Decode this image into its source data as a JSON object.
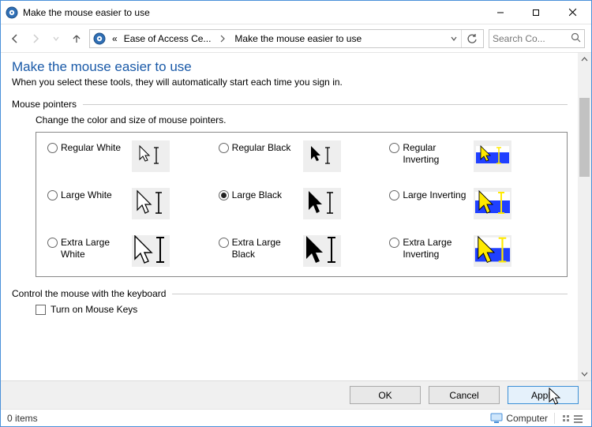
{
  "window": {
    "title": "Make the mouse easier to use"
  },
  "nav": {
    "crumb1": "Ease of Access Ce...",
    "crumb2": "Make the mouse easier to use",
    "search_placeholder": "Search Co..."
  },
  "page": {
    "title": "Make the mouse easier to use",
    "subtitle": "When you select these tools, they will automatically start each time you sign in."
  },
  "pointers_group": {
    "label": "Mouse pointers",
    "desc": "Change the color and size of mouse pointers.",
    "options": {
      "reg_white": "Regular White",
      "reg_black": "Regular Black",
      "reg_inv": "Regular Inverting",
      "large_white": "Large White",
      "large_black": "Large Black",
      "large_inv": "Large Inverting",
      "xl_white": "Extra Large White",
      "xl_black": "Extra Large Black",
      "xl_inv": "Extra Large Inverting"
    },
    "selected": "large_black"
  },
  "keyboard_group": {
    "label": "Control the mouse with the keyboard",
    "mouse_keys_label": "Turn on Mouse Keys",
    "mouse_keys_checked": false
  },
  "buttons": {
    "ok": "OK",
    "cancel": "Cancel",
    "apply": "Apply"
  },
  "status": {
    "items": "0 items",
    "computer": "Computer"
  }
}
